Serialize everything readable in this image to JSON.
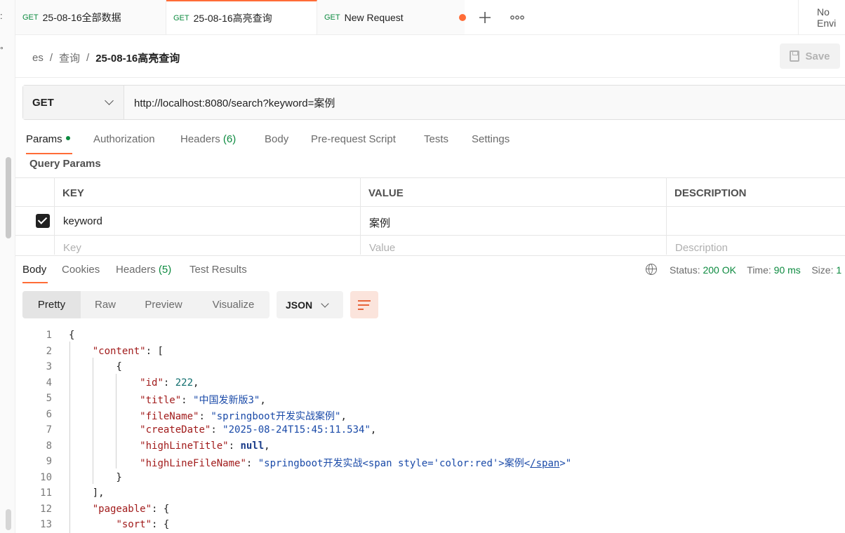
{
  "sidebar_gutter": {
    "top_glyph": ":",
    "mid_glyph": "°"
  },
  "tabs": [
    {
      "method": "GET",
      "name": "25-08-16全部数据",
      "active": false
    },
    {
      "method": "GET",
      "name": "25-08-16高亮查询",
      "active": true
    },
    {
      "method": "GET",
      "name": "New Request",
      "active": false,
      "unsaved": true
    }
  ],
  "tab_actions": {
    "add_icon": "plus-icon",
    "more_icon": "more-icon"
  },
  "environment": {
    "label": "No Envi"
  },
  "breadcrumb": {
    "items": [
      "es",
      "查询"
    ],
    "current": "25-08-16高亮查询"
  },
  "save_button": {
    "label": "Save",
    "icon": "save-icon"
  },
  "request": {
    "method": "GET",
    "url": "http://localhost:8080/search?keyword=案例"
  },
  "request_tabs": [
    {
      "label": "Params",
      "active": true,
      "indicator": true
    },
    {
      "label": "Authorization"
    },
    {
      "label": "Headers",
      "count": "(6)"
    },
    {
      "label": "Body"
    },
    {
      "label": "Pre-request Script"
    },
    {
      "label": "Tests"
    },
    {
      "label": "Settings"
    }
  ],
  "query_params": {
    "title": "Query Params",
    "headers": [
      "KEY",
      "VALUE",
      "DESCRIPTION"
    ],
    "rows": [
      {
        "checked": true,
        "key": "keyword",
        "value": "案例",
        "description": ""
      }
    ],
    "placeholders": {
      "key": "Key",
      "value": "Value",
      "description": "Description"
    }
  },
  "response_tabs": [
    {
      "label": "Body",
      "active": true
    },
    {
      "label": "Cookies"
    },
    {
      "label": "Headers",
      "count": "(5)"
    },
    {
      "label": "Test Results"
    }
  ],
  "response_status": {
    "status_label": "Status:",
    "status_value": "200 OK",
    "time_label": "Time:",
    "time_value": "90 ms",
    "size_label": "Size:",
    "size_value": "1"
  },
  "view_modes": [
    "Pretty",
    "Raw",
    "Preview",
    "Visualize"
  ],
  "active_view_mode": "Pretty",
  "format": "JSON",
  "colors": {
    "accent": "#ff6c37",
    "success": "#0c8a3f",
    "get_method": "#0c8a3f"
  },
  "code_lines": [
    {
      "n": "1",
      "html": "{"
    },
    {
      "n": "2",
      "html": "    <span class=\"k\">\"content\"</span>: ["
    },
    {
      "n": "3",
      "html": "        {"
    },
    {
      "n": "4",
      "html": "            <span class=\"k\">\"id\"</span>: <span class=\"n\">222</span>,"
    },
    {
      "n": "5",
      "html": "            <span class=\"k\">\"title\"</span>: <span class=\"s\">\"中国发新版3\"</span>,"
    },
    {
      "n": "6",
      "html": "            <span class=\"k\">\"fileName\"</span>: <span class=\"s\">\"springboot开发实战案例\"</span>,"
    },
    {
      "n": "7",
      "html": "            <span class=\"k\">\"createDate\"</span>: <span class=\"s\">\"2025-08-24T15:45:11.534\"</span>,"
    },
    {
      "n": "8",
      "html": "            <span class=\"k\">\"highLineTitle\"</span>: <span class=\"nul\">null</span>,"
    },
    {
      "n": "9",
      "html": "            <span class=\"k\">\"highLineFileName\"</span>: <span class=\"s\">\"springboot开发实战&lt;span style='color:red'&gt;案例&lt;<u>/span</u>&gt;\"</span>"
    },
    {
      "n": "10",
      "html": "        }"
    },
    {
      "n": "11",
      "html": "    ],"
    },
    {
      "n": "12",
      "html": "    <span class=\"k\">\"pageable\"</span>: {"
    },
    {
      "n": "13",
      "html": "        <span class=\"k\">\"sort\"</span>: {"
    }
  ]
}
